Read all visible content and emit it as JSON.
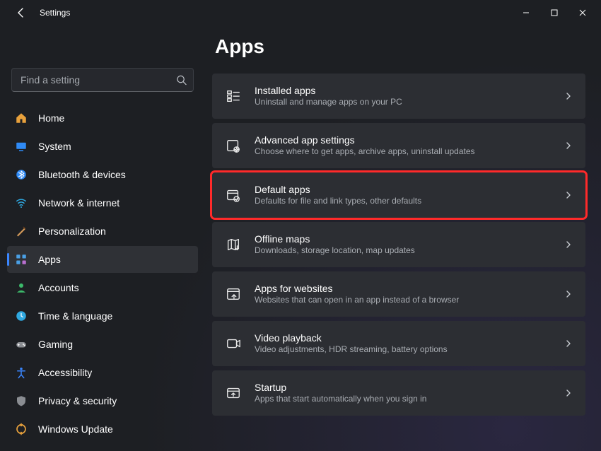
{
  "window": {
    "title": "Settings"
  },
  "search": {
    "placeholder": "Find a setting"
  },
  "nav": {
    "items": [
      {
        "id": "home",
        "label": "Home",
        "selected": false
      },
      {
        "id": "system",
        "label": "System",
        "selected": false
      },
      {
        "id": "bluetooth",
        "label": "Bluetooth & devices",
        "selected": false
      },
      {
        "id": "network",
        "label": "Network & internet",
        "selected": false
      },
      {
        "id": "personalization",
        "label": "Personalization",
        "selected": false
      },
      {
        "id": "apps",
        "label": "Apps",
        "selected": true
      },
      {
        "id": "accounts",
        "label": "Accounts",
        "selected": false
      },
      {
        "id": "time",
        "label": "Time & language",
        "selected": false
      },
      {
        "id": "gaming",
        "label": "Gaming",
        "selected": false
      },
      {
        "id": "accessibility",
        "label": "Accessibility",
        "selected": false
      },
      {
        "id": "privacy",
        "label": "Privacy & security",
        "selected": false
      },
      {
        "id": "update",
        "label": "Windows Update",
        "selected": false
      }
    ]
  },
  "page": {
    "title": "Apps"
  },
  "cards": [
    {
      "id": "installed",
      "title": "Installed apps",
      "sub": "Uninstall and manage apps on your PC",
      "highlighted": false
    },
    {
      "id": "advanced",
      "title": "Advanced app settings",
      "sub": "Choose where to get apps, archive apps, uninstall updates",
      "highlighted": false
    },
    {
      "id": "default",
      "title": "Default apps",
      "sub": "Defaults for file and link types, other defaults",
      "highlighted": true
    },
    {
      "id": "maps",
      "title": "Offline maps",
      "sub": "Downloads, storage location, map updates",
      "highlighted": false
    },
    {
      "id": "websites",
      "title": "Apps for websites",
      "sub": "Websites that can open in an app instead of a browser",
      "highlighted": false
    },
    {
      "id": "video",
      "title": "Video playback",
      "sub": "Video adjustments, HDR streaming, battery options",
      "highlighted": false
    },
    {
      "id": "startup",
      "title": "Startup",
      "sub": "Apps that start automatically when you sign in",
      "highlighted": false
    }
  ]
}
